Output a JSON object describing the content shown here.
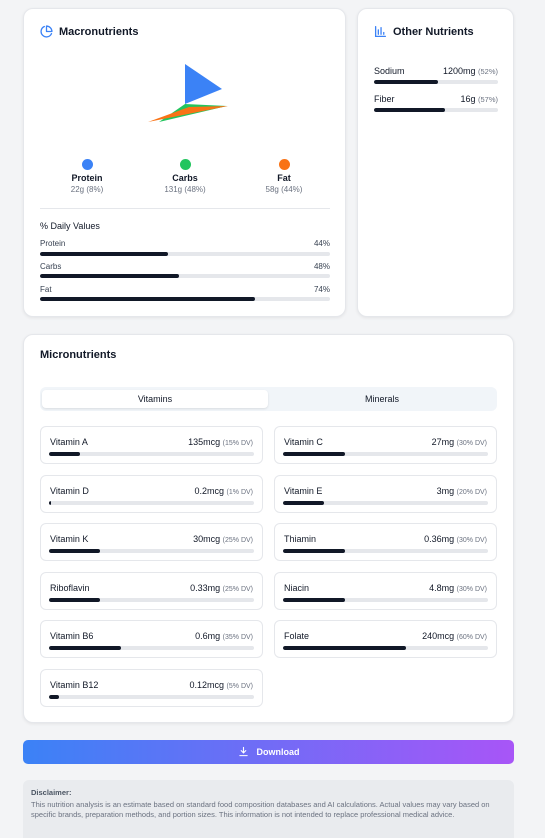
{
  "macronutrients": {
    "title": "Macronutrients",
    "legend": [
      {
        "name": "Protein",
        "detail": "22g (8%)",
        "color": "#3b82f6"
      },
      {
        "name": "Carbs",
        "detail": "131g (48%)",
        "color": "#22c55e"
      },
      {
        "name": "Fat",
        "detail": "58g (44%)",
        "color": "#f97316"
      }
    ],
    "daily_values_title": "% Daily Values",
    "daily_values": [
      {
        "name": "Protein",
        "percent_label": "44%",
        "percent": 44
      },
      {
        "name": "Carbs",
        "percent_label": "48%",
        "percent": 48
      },
      {
        "name": "Fat",
        "percent_label": "74%",
        "percent": 74
      }
    ]
  },
  "other_nutrients": {
    "title": "Other Nutrients",
    "items": [
      {
        "name": "Sodium",
        "value": "1200mg",
        "dv": "(52%)",
        "percent": 52
      },
      {
        "name": "Fiber",
        "value": "16g",
        "dv": "(57%)",
        "percent": 57
      }
    ]
  },
  "micronutrients": {
    "title": "Micronutrients",
    "tabs": [
      {
        "label": "Vitamins",
        "active": true
      },
      {
        "label": "Minerals",
        "active": false
      }
    ],
    "vitamins": [
      {
        "name": "Vitamin A",
        "value": "135mcg",
        "dv": "(15% DV)",
        "percent": 15
      },
      {
        "name": "Vitamin C",
        "value": "27mg",
        "dv": "(30% DV)",
        "percent": 30
      },
      {
        "name": "Vitamin D",
        "value": "0.2mcg",
        "dv": "(1% DV)",
        "percent": 1
      },
      {
        "name": "Vitamin E",
        "value": "3mg",
        "dv": "(20% DV)",
        "percent": 20
      },
      {
        "name": "Vitamin K",
        "value": "30mcg",
        "dv": "(25% DV)",
        "percent": 25
      },
      {
        "name": "Thiamin",
        "value": "0.36mg",
        "dv": "(30% DV)",
        "percent": 30
      },
      {
        "name": "Riboflavin",
        "value": "0.33mg",
        "dv": "(25% DV)",
        "percent": 25
      },
      {
        "name": "Niacin",
        "value": "4.8mg",
        "dv": "(30% DV)",
        "percent": 30
      },
      {
        "name": "Vitamin B6",
        "value": "0.6mg",
        "dv": "(35% DV)",
        "percent": 35
      },
      {
        "name": "Folate",
        "value": "240mcg",
        "dv": "(60% DV)",
        "percent": 60
      },
      {
        "name": "Vitamin B12",
        "value": "0.12mcg",
        "dv": "(5% DV)",
        "percent": 5
      }
    ]
  },
  "download_label": "Download",
  "disclaimer": {
    "title": "Disclaimer:",
    "text": "This nutrition analysis is an estimate based on standard food composition databases and AI calculations. Actual values may vary based on specific brands, preparation methods, and portion sizes. This information is not intended to replace professional medical advice."
  },
  "colors": {
    "accent_blue": "#3b82f6",
    "bar_dark": "#111827",
    "gradient_end": "#a855f7"
  }
}
